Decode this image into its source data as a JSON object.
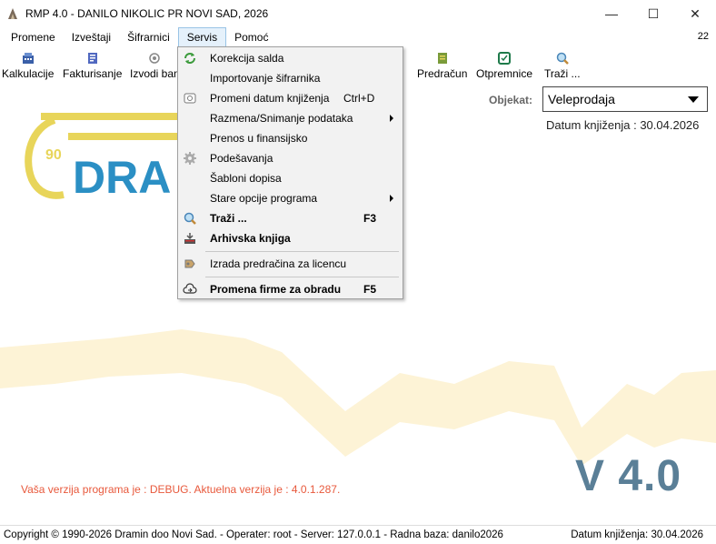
{
  "window": {
    "title": "RMP 4.0 - DANILO NIKOLIC PR NOVI SAD, 2026",
    "minimize": "—",
    "maximize": "☐",
    "close": "✕"
  },
  "menubar": {
    "items": [
      "Promene",
      "Izveštaji",
      "Šifrarnici",
      "Servis",
      "Pomoć"
    ],
    "active": "Servis",
    "right_value": "22"
  },
  "toolbar": {
    "items": [
      {
        "label": "Kalkulacije",
        "icon": "calculation-icon"
      },
      {
        "label": "Fakturisanje",
        "icon": "invoice-icon"
      },
      {
        "label": "Izvodi ban",
        "icon": "bank-statement-icon"
      },
      {
        "label": "Predračun",
        "icon": "estimate-icon"
      },
      {
        "label": "Otpremnice",
        "icon": "delivery-note-icon"
      },
      {
        "label": "Traži ...",
        "icon": "search-icon"
      }
    ]
  },
  "main": {
    "objekat_label": "Objekat:",
    "objekat_value": "Veleprodaja",
    "datum": "Datum knjiženja : 30.04.2026",
    "logo_text": "DRA",
    "logo_prefix": "90",
    "debug_message": "Vaša verzija programa je : DEBUG. Aktuelna verzija je : 4.0.1.287.",
    "version": "V 4.0"
  },
  "servis_menu": {
    "items": [
      {
        "label": "Korekcija salda",
        "shortcut": "",
        "icon": "refresh-icon",
        "bold": false,
        "submenu": false
      },
      {
        "label": "Importovanje šifrarnika",
        "shortcut": "",
        "icon": "",
        "bold": false,
        "submenu": false
      },
      {
        "label": "Promeni datum knjiženja",
        "shortcut": "Ctrl+D",
        "icon": "calendar-icon",
        "bold": false,
        "submenu": false
      },
      {
        "label": "Razmena/Snimanje podataka",
        "shortcut": "",
        "icon": "",
        "bold": false,
        "submenu": true
      },
      {
        "label": "Prenos u finansijsko",
        "shortcut": "",
        "icon": "",
        "bold": false,
        "submenu": false
      },
      {
        "label": "Podešavanja",
        "shortcut": "",
        "icon": "gear-icon",
        "bold": false,
        "submenu": false
      },
      {
        "label": "Šabloni dopisa",
        "shortcut": "",
        "icon": "",
        "bold": false,
        "submenu": false
      },
      {
        "label": "Stare opcije programa",
        "shortcut": "",
        "icon": "",
        "bold": false,
        "submenu": true
      },
      {
        "label": "Traži ...",
        "shortcut": "F3",
        "icon": "search-icon",
        "bold": true,
        "submenu": false
      },
      {
        "label": "Arhivska knjiga",
        "shortcut": "",
        "icon": "archive-icon",
        "bold": true,
        "submenu": false
      },
      {
        "label": "Izrada predračina za licencu",
        "shortcut": "",
        "icon": "license-icon",
        "bold": false,
        "submenu": false
      },
      {
        "label": "Promena firme za obradu",
        "shortcut": "F5",
        "icon": "cloud-switch-icon",
        "bold": true,
        "submenu": false
      }
    ]
  },
  "statusbar": {
    "left": "Copyright © 1990-2026 Dramin doo Novi Sad. - Operater: root - Server: 127.0.0.1 - Radna baza: danilo2026",
    "right": "Datum knjiženja: 30.04.2026"
  },
  "colors": {
    "logo_blue": "#2b8fc4",
    "logo_yellow": "#e8d55a",
    "watermark": "#fdf3d6",
    "debug_red": "#e8593c",
    "version_blue": "#5a7f97",
    "active_menu_bg": "#e5f1fb"
  }
}
